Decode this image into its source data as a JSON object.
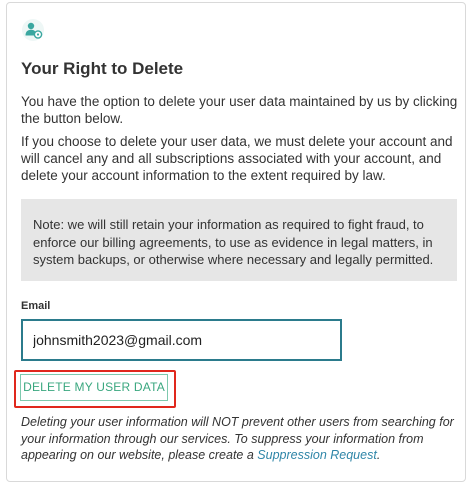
{
  "section": {
    "icon": "user-settings-icon",
    "title": "Your Right to Delete",
    "intro": "You have the option to delete your user data maintained by us by clicking the button below.",
    "details": "If you choose to delete your user data, we must delete your account and will cancel any and all subscriptions associated with your account, and delete your account information to the extent required by law.",
    "note": "Note: we will still retain your information as required to fight fraud, to enforce our billing agreements, to use as evidence in legal matters, in system backups, or otherwise where necessary and legally permitted."
  },
  "email": {
    "label": "Email",
    "value": "johnsmith2023@gmail.com"
  },
  "delete_button": {
    "label": "DELETE MY USER DATA"
  },
  "footer": {
    "text_before_link": "Deleting your user information will NOT prevent other users from searching for your information through our services. To suppress your information from appearing on our website, please create a ",
    "link_label": "Suppression Request",
    "text_after_link": "."
  },
  "colors": {
    "accent_teal": "#2b7b8c",
    "button_green": "#3aa77f",
    "highlight_red": "#e0281d",
    "link_blue": "#2f86a8",
    "note_bg": "#e6e6e6"
  }
}
